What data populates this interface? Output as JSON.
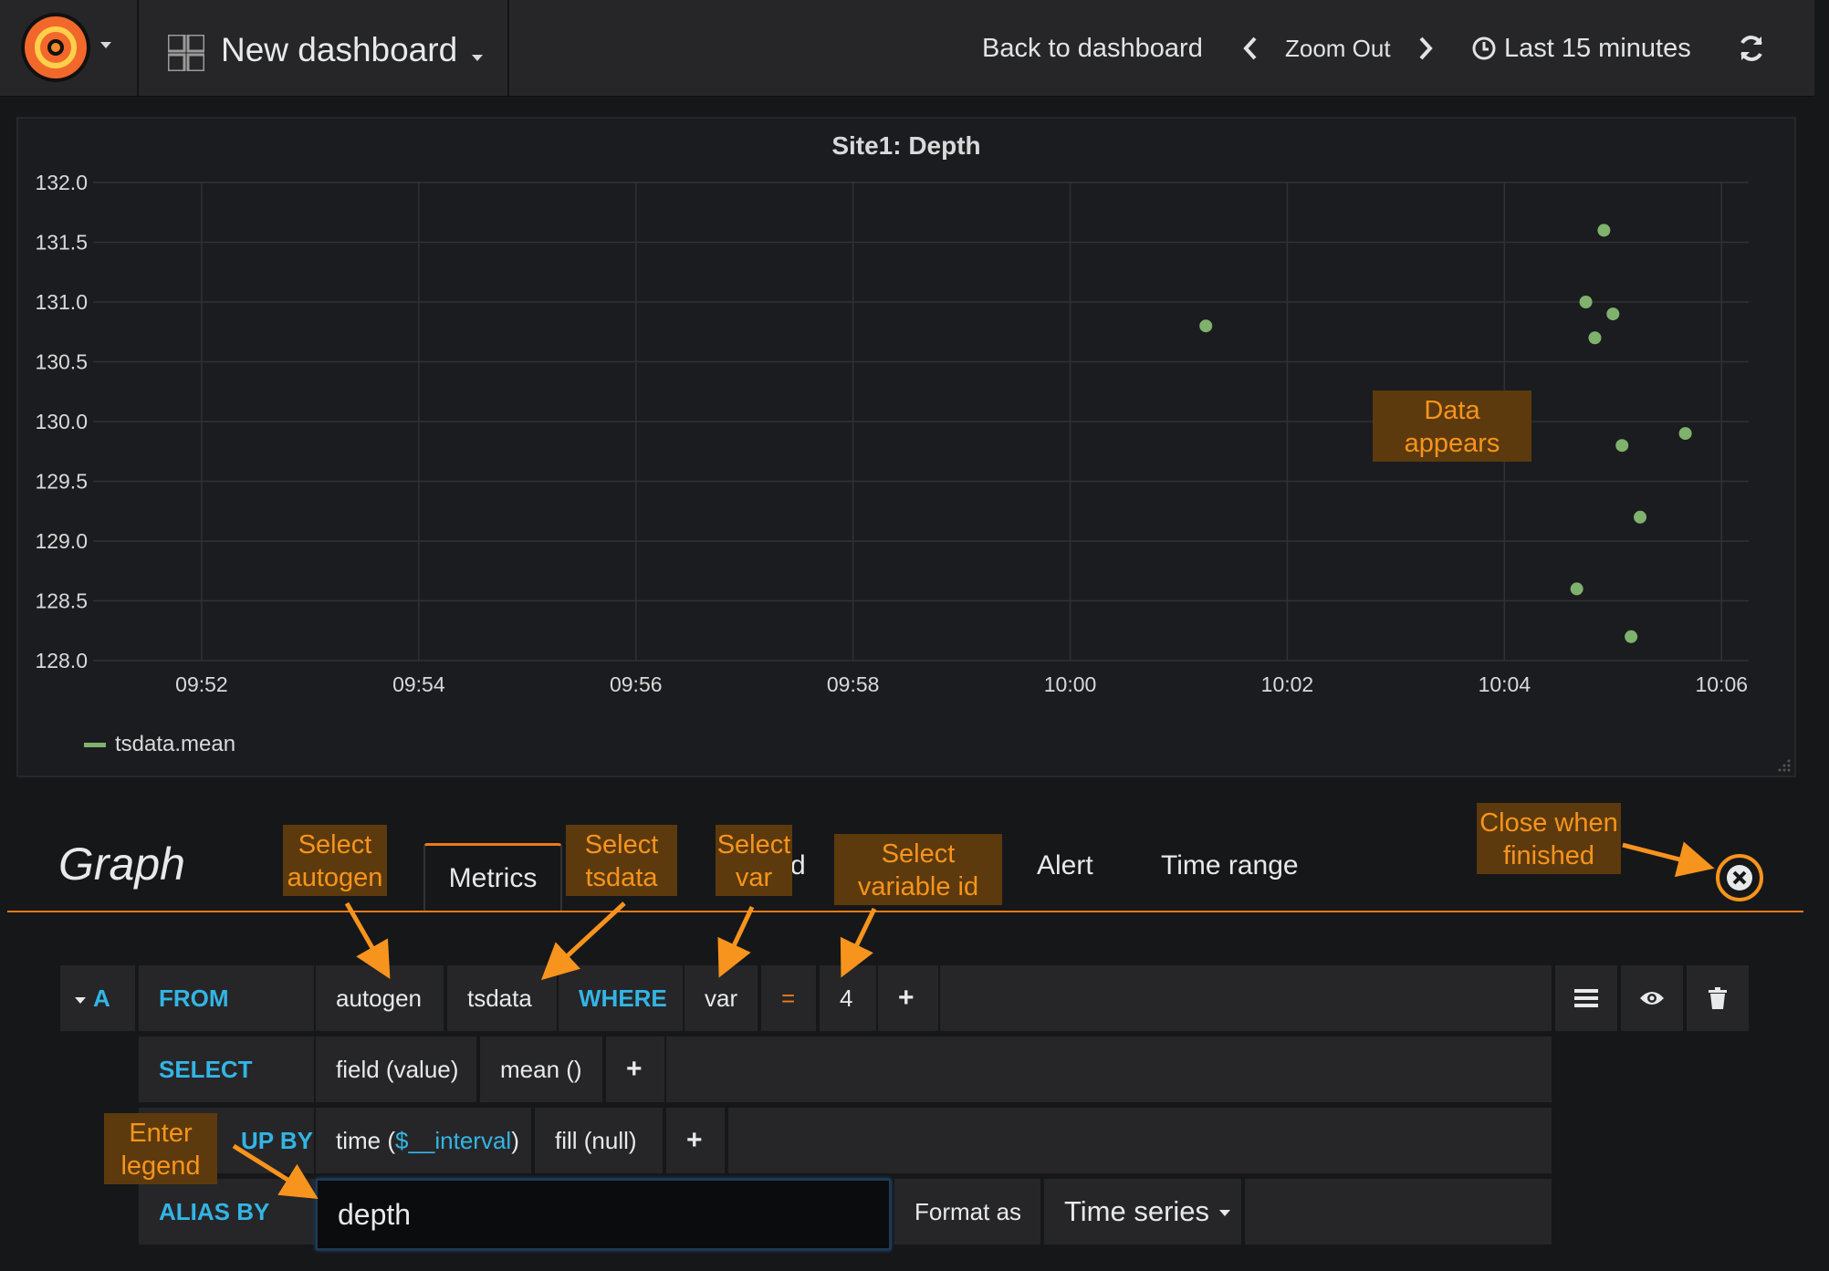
{
  "navbar": {
    "dashboard_title": "New dashboard",
    "back_label": "Back to dashboard",
    "zoom_out_label": "Zoom Out",
    "time_range_label": "Last 15 minutes"
  },
  "panel": {
    "title": "Site1: Depth",
    "legend_label": "tsdata.mean"
  },
  "chart_data": {
    "type": "scatter",
    "title": "Site1: Depth",
    "xlabel": "",
    "ylabel": "",
    "x_ticks": [
      "09:52",
      "09:54",
      "09:56",
      "09:58",
      "10:00",
      "10:02",
      "10:04",
      "10:06"
    ],
    "y_ticks": [
      "128.0",
      "128.5",
      "129.0",
      "129.5",
      "130.0",
      "130.5",
      "131.0",
      "131.5",
      "132.0"
    ],
    "xlim": [
      "09:51:00",
      "10:06:15"
    ],
    "ylim": [
      128.0,
      132.0
    ],
    "grid": true,
    "legend_position": "bottom-left",
    "series": [
      {
        "name": "tsdata.mean",
        "color": "#7eb26d",
        "points": [
          {
            "x": "10:01:15",
            "y": 130.8
          },
          {
            "x": "10:04:40",
            "y": 128.6
          },
          {
            "x": "10:04:45",
            "y": 131.0
          },
          {
            "x": "10:04:50",
            "y": 130.7
          },
          {
            "x": "10:04:55",
            "y": 131.6
          },
          {
            "x": "10:05:00",
            "y": 130.9
          },
          {
            "x": "10:05:05",
            "y": 129.8
          },
          {
            "x": "10:05:10",
            "y": 128.2
          },
          {
            "x": "10:05:15",
            "y": 129.2
          },
          {
            "x": "10:05:40",
            "y": 129.9
          }
        ]
      }
    ]
  },
  "editor": {
    "panel_type": "Graph",
    "tabs": [
      "Metrics",
      "d",
      "Alert",
      "Time range"
    ]
  },
  "query": {
    "ref": "A",
    "from_kw": "FROM",
    "retention": "autogen",
    "measurement": "tsdata",
    "where_kw": "WHERE",
    "tag_key": "var",
    "operator": "=",
    "tag_value": "4",
    "plus": "+",
    "select_kw": "SELECT",
    "field": "field (value)",
    "agg": "mean ()",
    "group_kw": "UP BY",
    "time_prefix": "time (",
    "time_var": "$__interval",
    "time_suffix": ")",
    "fill": "fill (null)",
    "alias_kw": "ALIAS BY",
    "alias_value": "depth",
    "format_label": "Format as",
    "format_value": "Time series"
  },
  "annotations": {
    "data_appears": "Data appears",
    "select_autogen": "Select autogen",
    "select_tsdata": "Select tsdata",
    "select_var": "Select var",
    "select_variable_id": "Select variable id",
    "close_when_finished": "Close when finished",
    "enter_legend": "Enter legend",
    "annotation_color": "#f7941d"
  }
}
